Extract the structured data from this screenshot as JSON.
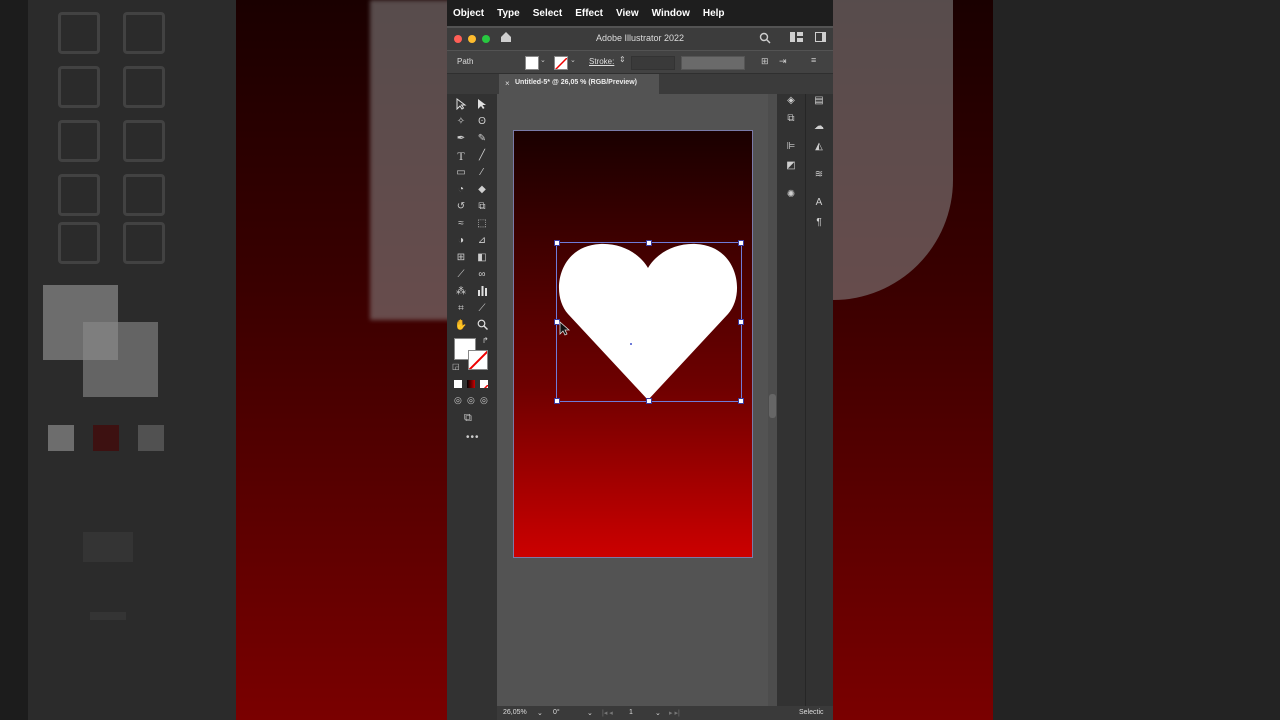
{
  "menu": [
    "Object",
    "Type",
    "Select",
    "Effect",
    "View",
    "Window",
    "Help"
  ],
  "app_title": "Adobe Illustrator 2022",
  "control_bar": {
    "selection_type": "Path",
    "stroke_label": "Stroke:"
  },
  "document_tab": {
    "close": "×",
    "title": "Untitled-5* @ 26,05 % (RGB/Preview)"
  },
  "status_bar": {
    "zoom": "26,05%",
    "rotation": "0°",
    "artboard_number": "1",
    "tool_name": "Selectic"
  },
  "colors": {
    "heart_fill": "#ffffff",
    "gradient_top": "#1a0000",
    "gradient_bottom": "#cc0000",
    "selection": "#6e7bd9"
  },
  "tools": [
    "selection-tool",
    "direct-selection-tool",
    "magic-wand-tool",
    "lasso-tool",
    "pen-tool",
    "curvature-tool",
    "type-tool",
    "line-tool",
    "rectangle-tool",
    "paintbrush-tool",
    "shaper-tool",
    "eraser-tool",
    "rotate-tool",
    "scale-tool",
    "warp-tool",
    "free-transform-tool",
    "shape-builder-tool",
    "perspective-tool",
    "mesh-tool",
    "gradient-tool",
    "eyedropper-tool",
    "blend-tool",
    "symbol-sprayer-tool",
    "graph-tool",
    "artboard-tool",
    "slice-tool",
    "hand-tool",
    "zoom-tool"
  ]
}
